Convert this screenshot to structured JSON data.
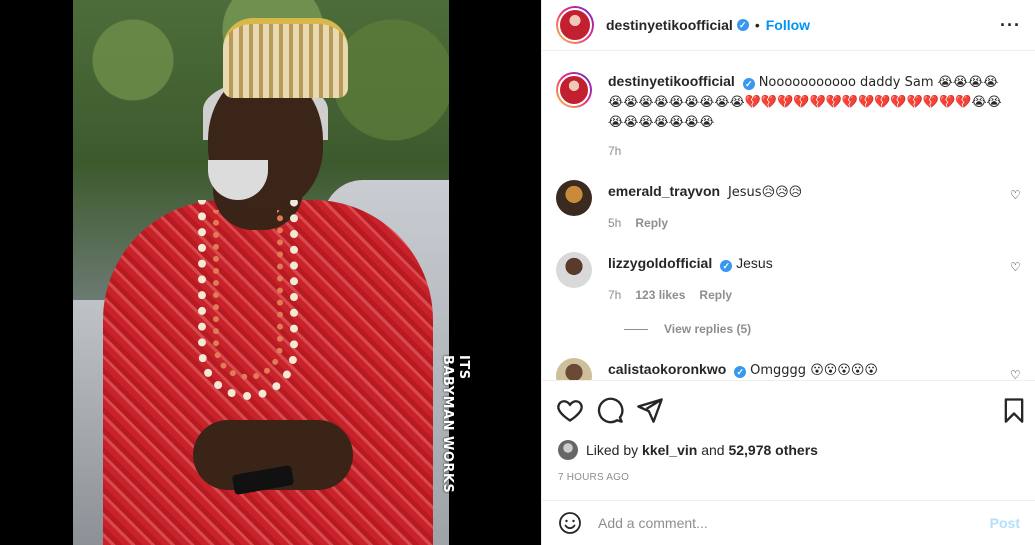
{
  "media": {
    "watermark_line1": "ITS",
    "watermark_line2": "BABYMAN WORKS"
  },
  "header": {
    "username": "destinyetikoofficial",
    "dot": "•",
    "follow_label": "Follow",
    "more_icon": "more-horizontal-icon"
  },
  "caption": {
    "username": "destinyetikoofficial",
    "text": "Nooooooooooo daddy Sam 😭😭😭😭😭😭😭😭😭😭😭😭😭💔💔💔💔💔💔💔💔💔💔💔💔💔💔😭😭😭😭😭😭😭😭😭",
    "time": "7h"
  },
  "comments": [
    {
      "username": "emerald_trayvon",
      "verified": false,
      "text": "Jesus😥😥😥",
      "time": "5h",
      "likes": "",
      "reply_label": "Reply"
    },
    {
      "username": "lizzygoldofficial",
      "verified": true,
      "text": "Jesus",
      "time": "7h",
      "likes": "123 likes",
      "reply_label": "Reply",
      "view_replies": "View replies (5)"
    },
    {
      "username": "calistaokoronkwo",
      "verified": true,
      "text": "Omgggg 😮😮😮😮😮",
      "time": "",
      "likes": "",
      "reply_label": ""
    }
  ],
  "actions": {
    "like_icon": "heart-icon",
    "comment_icon": "comment-icon",
    "share_icon": "share-icon",
    "save_icon": "bookmark-icon"
  },
  "likes": {
    "prefix": "Liked by",
    "user": "kkel_vin",
    "conj": "and",
    "others": "52,978 others"
  },
  "timestamp": "7 HOURS AGO",
  "add_comment": {
    "placeholder": "Add a comment...",
    "post_label": "Post"
  },
  "colors": {
    "accent": "#0095f6",
    "verified": "#3897f0",
    "post_disabled": "#b2dffc"
  }
}
